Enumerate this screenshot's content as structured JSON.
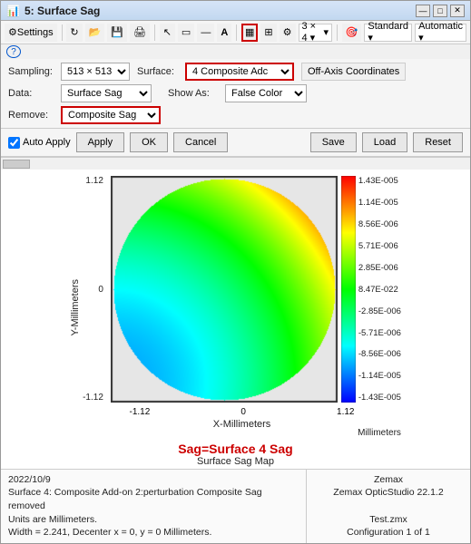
{
  "window": {
    "title": "5: Surface Sag",
    "title_icon": "📊"
  },
  "title_buttons": {
    "minimize": "—",
    "maximize": "□",
    "close": "✕"
  },
  "toolbar": {
    "settings_label": "Settings",
    "dropdown_standard": "Standard ▾",
    "dropdown_automatic": "Automatic ▾",
    "grid_label": "3 × 4 ▾"
  },
  "help_icon": "?",
  "controls": {
    "sampling_label": "Sampling:",
    "sampling_value": "513 × 513",
    "surface_label": "Surface:",
    "surface_value": "4 Composite Adc",
    "off_axis_label": "Off-Axis Coordinates",
    "data_label": "Data:",
    "data_value": "Surface Sag",
    "show_as_label": "Show As:",
    "show_as_value": "False Color",
    "remove_label": "Remove:",
    "remove_value": "Composite Sag"
  },
  "buttons": {
    "auto_apply_label": "Auto Apply",
    "auto_apply_checked": true,
    "apply_label": "Apply",
    "ok_label": "OK",
    "cancel_label": "Cancel",
    "save_label": "Save",
    "load_label": "Load",
    "reset_label": "Reset"
  },
  "chart": {
    "y_axis_label": "Y-Millimeters",
    "x_axis_label": "X-Millimeters",
    "y_ticks": [
      "1.12",
      "0",
      "-1.12"
    ],
    "x_ticks": [
      "-1.12",
      "0",
      "1.12"
    ],
    "colorbar_unit": "Millimeters",
    "colorbar_values": [
      "1.43E-005",
      "1.14E-005",
      "8.56E-006",
      "5.71E-006",
      "2.85E-006",
      "8.47E-022",
      "-2.85E-006",
      "-5.71E-006",
      "-8.56E-006",
      "-1.14E-005",
      "-1.43E-005"
    ],
    "title": "Sag=Surface 4 Sag",
    "subtitle": "Surface Sag Map"
  },
  "info": {
    "left_line1": "2022/10/9",
    "left_line2": "Surface 4: Composite Add-on 2:perturbation Composite Sag removed",
    "left_line3": "Units are Millimeters.",
    "left_line4": "Width = 2.241, Decenter x = 0, y = 0 Millimeters.",
    "right_line1": "Zemax",
    "right_line2": "Zemax OpticStudio 22.1.2",
    "right_line3": "",
    "right_line4": "Test.zmx",
    "right_line5": "Configuration 1 of 1"
  }
}
